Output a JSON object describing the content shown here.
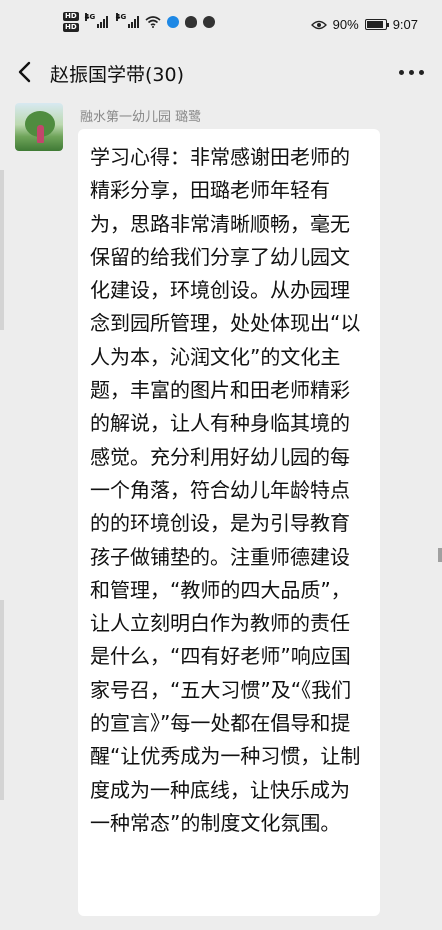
{
  "status_bar": {
    "hd_badges": [
      "HD",
      "HD"
    ],
    "network_1": "4G",
    "network_2": "4G",
    "battery_percent": "90%",
    "battery_level": 0.9,
    "time": "9:07"
  },
  "header": {
    "title": "赵振国学带(30)",
    "back_icon": "chevron-left-icon",
    "more_icon": "more-horizontal-icon"
  },
  "message": {
    "sender_name": "融水第一幼儿园 璐鹭",
    "text": "学习心得：非常感谢田老师的精彩分享，田璐老师年轻有为，思路非常清晰顺畅，毫无保留的给我们分享了幼儿园文化建设，环境创设。从办园理念到园所管理，处处体现出“以人为本，沁润文化”的文化主题，丰富的图片和田老师精彩的解说，让人有种身临其境的感觉。充分利用好幼儿园的每一个角落，符合幼儿年龄特点的的环境创设，是为引导教育孩子做铺垫的。注重师德建设和管理，“教师的四大品质”，让人立刻明白作为教师的责任是什么，“四有好老师”响应国家号召，“五大习惯”及“《我们的宣言》”每一处都在倡导和提醒“让优秀成为一种习惯，让制度成为一种底线，让快乐成为一种常态”的制度文化氛围。"
  },
  "colors": {
    "background": "#ededed",
    "bubble": "#ffffff",
    "sender_text": "#888888",
    "icon_green": "#07c160",
    "icon_blue": "#1e88e5"
  }
}
